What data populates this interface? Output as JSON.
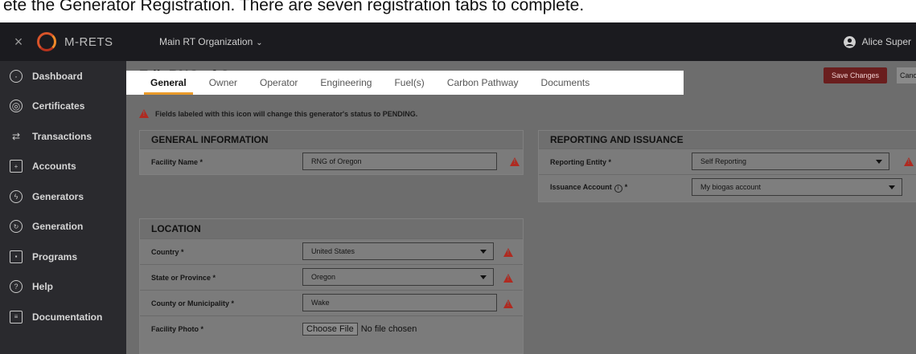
{
  "caption": "ete the Generator Registration. There are seven registration tabs to complete.",
  "topbar": {
    "close_glyph": "×",
    "brand": "M-RETS",
    "organization": "Main RT Organization",
    "user_name": "Alice Super"
  },
  "sidebar": {
    "items": [
      {
        "label": "Dashboard",
        "icon": "dashboard-icon"
      },
      {
        "label": "Certificates",
        "icon": "certificate-icon"
      },
      {
        "label": "Transactions",
        "icon": "transfer-arrows-icon"
      },
      {
        "label": "Accounts",
        "icon": "accounts-icon"
      },
      {
        "label": "Generators",
        "icon": "generator-icon"
      },
      {
        "label": "Generation",
        "icon": "generation-icon"
      },
      {
        "label": "Programs",
        "icon": "programs-icon"
      },
      {
        "label": "Help",
        "icon": "help-icon"
      },
      {
        "label": "Documentation",
        "icon": "document-icon"
      }
    ]
  },
  "page": {
    "title": "Edit RNG of Oregon",
    "save_label": "Save Changes",
    "cancel_label": "Cancel",
    "notice": "Fields labeled with this icon will change this generator's status to PENDING."
  },
  "tabs": [
    "General",
    "Owner",
    "Operator",
    "Engineering",
    "Fuel(s)",
    "Carbon Pathway",
    "Documents"
  ],
  "general_info": {
    "heading": "GENERAL INFORMATION",
    "facility_name_label": "Facility Name *",
    "facility_name_value": "RNG of Oregon"
  },
  "reporting": {
    "heading": "REPORTING AND ISSUANCE",
    "entity_label": "Reporting Entity *",
    "entity_value": "Self Reporting",
    "account_label": "Issuance Account",
    "account_required": "*",
    "account_value": "My biogas account"
  },
  "location": {
    "heading": "LOCATION",
    "country_label": "Country *",
    "country_value": "United States",
    "state_label": "State or Province *",
    "state_value": "Oregon",
    "county_label": "County or Municipality *",
    "county_value": "Wake",
    "photo_label": "Facility Photo *",
    "choose_file": "Choose File",
    "no_file": "No file chosen"
  }
}
